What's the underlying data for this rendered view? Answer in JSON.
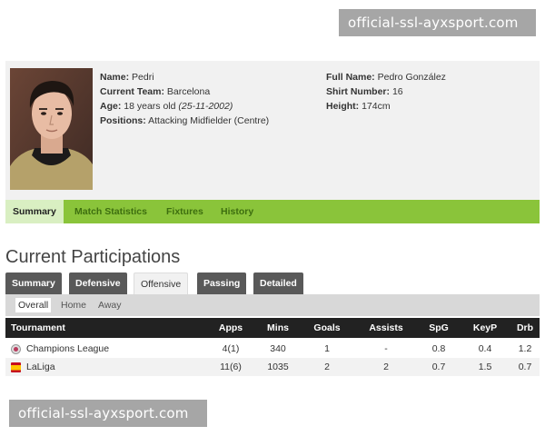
{
  "watermark": "official-ssl-ayxsport.com",
  "player": {
    "name_label": "Name:",
    "name": "Pedri",
    "team_label": "Current Team:",
    "team": "Barcelona",
    "age_label": "Age:",
    "age": "18 years old",
    "birthdate": "(25-11-2002)",
    "positions_label": "Positions:",
    "positions": "Attacking Midfielder (Centre)",
    "fullname_label": "Full Name:",
    "fullname": "Pedro González",
    "shirt_label": "Shirt Number:",
    "shirt": "16",
    "height_label": "Height:",
    "height": "174cm"
  },
  "tabs": [
    "Summary",
    "Match Statistics",
    "Fixtures",
    "History"
  ],
  "section_title": "Current Participations",
  "subtabs": [
    "Summary",
    "Defensive",
    "Offensive",
    "Passing",
    "Detailed"
  ],
  "filters": [
    "Overall",
    "Home",
    "Away"
  ],
  "table": {
    "headers": [
      "Tournament",
      "Apps",
      "Mins",
      "Goals",
      "Assists",
      "SpG",
      "KeyP",
      "Drb"
    ],
    "rows": [
      {
        "tournament": "Champions League",
        "apps": "4(1)",
        "mins": "340",
        "goals": "1",
        "assists": "-",
        "spg": "0.8",
        "keyp": "0.4",
        "drb": "1.2"
      },
      {
        "tournament": "LaLiga",
        "apps": "11(6)",
        "mins": "1035",
        "goals": "2",
        "assists": "2",
        "spg": "0.7",
        "keyp": "1.5",
        "drb": "0.7"
      }
    ]
  }
}
